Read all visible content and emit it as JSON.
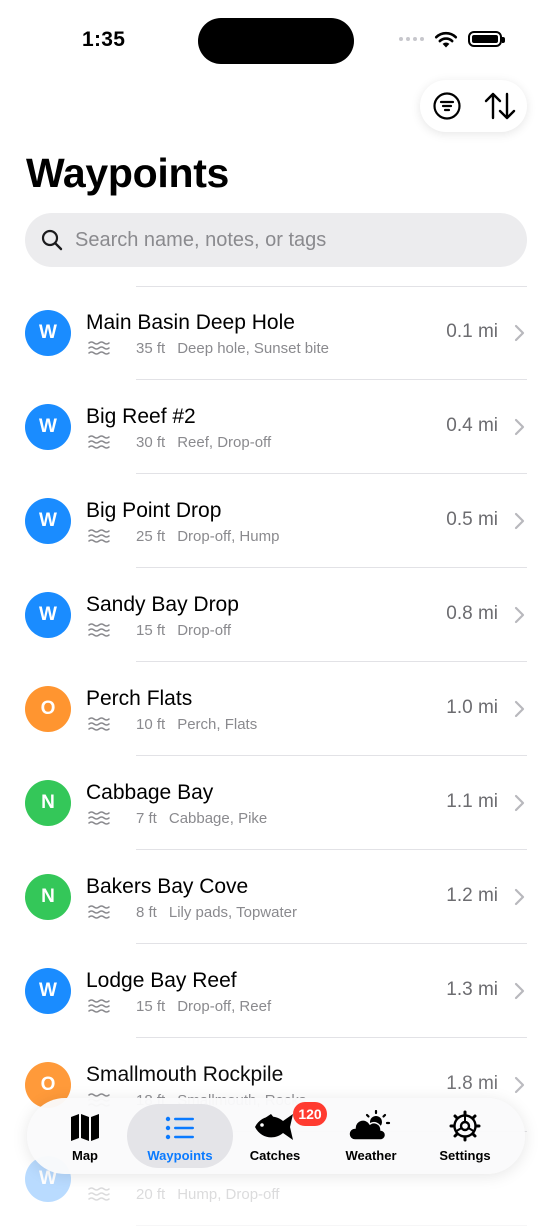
{
  "status": {
    "time": "1:35"
  },
  "page": {
    "title": "Waypoints"
  },
  "search": {
    "placeholder": "Search name, notes, or tags",
    "value": ""
  },
  "colors": {
    "blue": "#1a8cff",
    "orange": "#ff9530",
    "green": "#34c759",
    "accent": "#0a7aff"
  },
  "waypoints": [
    {
      "initial": "W",
      "color": "blue",
      "name": "Main Basin Deep Hole",
      "depth": "35 ft",
      "tags": "Deep hole, Sunset bite",
      "distance": "0.1 mi"
    },
    {
      "initial": "W",
      "color": "blue",
      "name": "Big Reef #2",
      "depth": "30 ft",
      "tags": "Reef, Drop-off",
      "distance": "0.4 mi"
    },
    {
      "initial": "W",
      "color": "blue",
      "name": "Big Point Drop",
      "depth": "25 ft",
      "tags": "Drop-off, Hump",
      "distance": "0.5 mi"
    },
    {
      "initial": "W",
      "color": "blue",
      "name": "Sandy Bay Drop",
      "depth": "15 ft",
      "tags": "Drop-off",
      "distance": "0.8 mi"
    },
    {
      "initial": "O",
      "color": "orange",
      "name": "Perch Flats",
      "depth": "10 ft",
      "tags": "Perch, Flats",
      "distance": "1.0 mi"
    },
    {
      "initial": "N",
      "color": "green",
      "name": "Cabbage Bay",
      "depth": "7 ft",
      "tags": "Cabbage, Pike",
      "distance": "1.1 mi"
    },
    {
      "initial": "N",
      "color": "green",
      "name": "Bakers Bay Cove",
      "depth": "8 ft",
      "tags": "Lily pads, Topwater",
      "distance": "1.2 mi"
    },
    {
      "initial": "W",
      "color": "blue",
      "name": "Lodge Bay Reef",
      "depth": "15 ft",
      "tags": "Drop-off, Reef",
      "distance": "1.3 mi"
    },
    {
      "initial": "O",
      "color": "orange",
      "name": "Smallmouth Rockpile",
      "depth": "18 ft",
      "tags": "Smallmouth, Rocks",
      "distance": "1.8 mi"
    },
    {
      "initial": "W",
      "color": "blue",
      "name": "",
      "depth": "20 ft",
      "tags": "Hump, Drop-off",
      "distance": ""
    }
  ],
  "tabbar": {
    "tabs": [
      {
        "key": "map",
        "label": "Map",
        "icon": "map-icon"
      },
      {
        "key": "waypoints",
        "label": "Waypoints",
        "icon": "list-icon",
        "active": true
      },
      {
        "key": "catches",
        "label": "Catches",
        "icon": "fish-icon",
        "badge": "120"
      },
      {
        "key": "weather",
        "label": "Weather",
        "icon": "weather-icon"
      },
      {
        "key": "settings",
        "label": "Settings",
        "icon": "gear-icon"
      }
    ]
  }
}
